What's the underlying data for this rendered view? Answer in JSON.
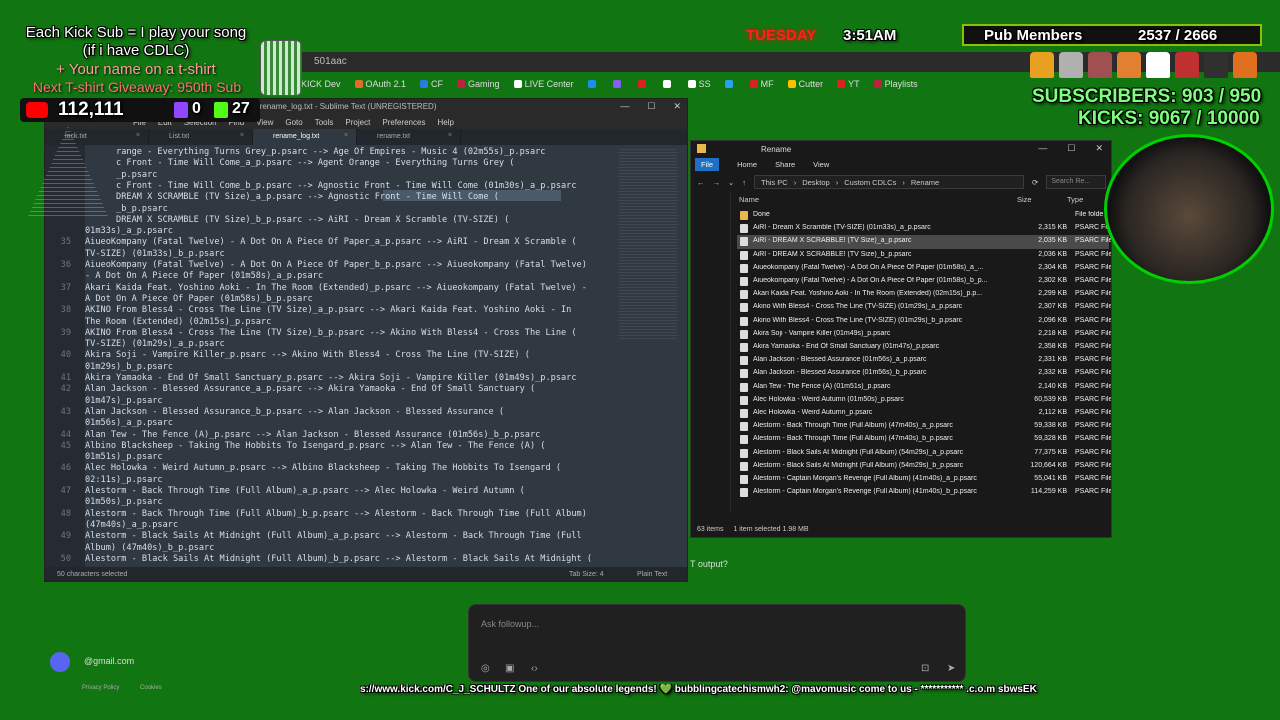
{
  "stream": {
    "kick_sub_line1": "Each Kick Sub = I play your song",
    "kick_sub_line2": "(if i have CDLC)",
    "tshirt_line": "+ Your name on a t-shirt",
    "giveaway_line": "Next T-shirt Giveaway: 950th Sub",
    "youtube_count": "112,111",
    "twitch_count": "0",
    "kick_count": "27",
    "day": "TUESDAY",
    "time": "3:51AM",
    "pub_members_label": "Pub Members",
    "pub_members_value": "2537 / 2666",
    "subscribers": "SUBSCRIBERS: 903 / 950",
    "kicks": "KICKS: 9067 / 10000",
    "ticker": "s://www.kick.com/C_J_SCHULTZ One of our absolute legends! 💚 bubblingcatechismwh2: @mavomusic come to us - *********** .c.o.m sbwsEK",
    "email_fragment": "@gmail.com",
    "privacy": "Privacy Policy",
    "cookies": "Cookies",
    "output_prompt": "T output?",
    "followup_placeholder": "Ask followup..."
  },
  "browser": {
    "url_fragment": "501aac",
    "bookmarks": [
      {
        "label": "KICK Dev",
        "color": "#53fc18"
      },
      {
        "label": "OAuth 2.1",
        "color": "#e06c2a"
      },
      {
        "label": "CF",
        "color": "#2a7be0"
      },
      {
        "label": "Gaming",
        "color": "#c02040"
      },
      {
        "label": "LIVE Center",
        "color": "#ffffff"
      },
      {
        "label": "",
        "color": "#1a8ff0"
      },
      {
        "label": "",
        "color": "#8a5cf0"
      },
      {
        "label": "",
        "color": "#e02020"
      },
      {
        "label": "",
        "color": "#ffffff"
      },
      {
        "label": "SS",
        "color": "#ffffff"
      },
      {
        "label": "",
        "color": "#2aa0f0"
      },
      {
        "label": "MF",
        "color": "#e02020"
      },
      {
        "label": "Cutter",
        "color": "#ffbf00"
      },
      {
        "label": "YT",
        "color": "#e02020"
      },
      {
        "label": "Playlists",
        "color": "#c02040"
      }
    ]
  },
  "sublime": {
    "title": "~\\Custom CDLCs\\rename_log.txt - Sublime Text (UNREGISTERED)",
    "menu": [
      "File",
      "Edit",
      "Selection",
      "Find",
      "View",
      "Goto",
      "Tools",
      "Project",
      "Preferences",
      "Help"
    ],
    "tabs": [
      {
        "label": "lock.txt",
        "active": false
      },
      {
        "label": "List.txt",
        "active": false
      },
      {
        "label": "rename_log.txt",
        "active": true
      },
      {
        "label": "rename.txt",
        "active": false
      }
    ],
    "lines": [
      {
        "n": "",
        "t": "      range - Everything Turns Grey_p.psarc --> Age Of Empires - Music 4 (02m55s)_p.psarc"
      },
      {
        "n": "",
        "t": "      c Front - Time Will Come_a_p.psarc --> Agent Orange - Everything Turns Grey ("
      },
      {
        "n": "",
        "t": "      _p.psarc"
      },
      {
        "n": "",
        "t": "      c Front - Time Will Come_b_p.psarc --> Agnostic Front - Time Will Come (01m30s)_a_p.psarc"
      },
      {
        "n": "",
        "t": "      DREAM X SCRAMBLE (TV Size)_a_p.psarc --> Agnostic Front - Time Will Come ("
      },
      {
        "n": "",
        "t": "      _b_p.psarc"
      },
      {
        "n": "",
        "t": "      DREAM X SCRAMBLE (TV Size)_b_p.psarc --> AiRI - Dream X Scramble (TV-SIZE) ("
      },
      {
        "n": "",
        "t": "01m33s)_a_p.psarc"
      },
      {
        "n": "35",
        "t": "AiueoKompany (Fatal Twelve) - A Dot On A Piece Of Paper_a_p.psarc --> AiRI - Dream X Scramble ("
      },
      {
        "n": "",
        "t": "TV-SIZE) (01m33s)_b_p.psarc"
      },
      {
        "n": "36",
        "t": "AiueoKompany (Fatal Twelve) - A Dot On A Piece Of Paper_b_p.psarc --> Aiueokompany (Fatal Twelve)"
      },
      {
        "n": "",
        "t": "- A Dot On A Piece Of Paper (01m58s)_a_p.psarc"
      },
      {
        "n": "37",
        "t": "Akari Kaida Feat. Yoshino Aoki - In The Room (Extended)_p.psarc --> Aiueokompany (Fatal Twelve) -"
      },
      {
        "n": "",
        "t": "A Dot On A Piece Of Paper (01m58s)_b_p.psarc"
      },
      {
        "n": "38",
        "t": "AKINO From Bless4 - Cross The Line (TV Size)_a_p.psarc --> Akari Kaida Feat. Yoshino Aoki - In"
      },
      {
        "n": "",
        "t": "The Room (Extended) (02m15s)_p.psarc"
      },
      {
        "n": "39",
        "t": "AKINO From Bless4 - Cross The Line (TV Size)_b_p.psarc --> Akino With Bless4 - Cross The Line ("
      },
      {
        "n": "",
        "t": "TV-SIZE) (01m29s)_a_p.psarc"
      },
      {
        "n": "40",
        "t": "Akira Soji - Vampire Killer_p.psarc --> Akino With Bless4 - Cross The Line (TV-SIZE) ("
      },
      {
        "n": "",
        "t": "01m29s)_b_p.psarc"
      },
      {
        "n": "41",
        "t": "Akira Yamaoka - End Of Small Sanctuary_p.psarc --> Akira Soji - Vampire Killer (01m49s)_p.psarc"
      },
      {
        "n": "42",
        "t": "Alan Jackson - Blessed Assurance_a_p.psarc --> Akira Yamaoka - End Of Small Sanctuary ("
      },
      {
        "n": "",
        "t": "01m47s)_p.psarc"
      },
      {
        "n": "43",
        "t": "Alan Jackson - Blessed Assurance_b_p.psarc --> Alan Jackson - Blessed Assurance ("
      },
      {
        "n": "",
        "t": "01m56s)_a_p.psarc"
      },
      {
        "n": "44",
        "t": "Alan Tew - The Fence (A)_p.psarc --> Alan Jackson - Blessed Assurance (01m56s)_b_p.psarc"
      },
      {
        "n": "45",
        "t": "Albino Blacksheep - Taking The Hobbits To Isengard_p.psarc --> Alan Tew - The Fence (A) ("
      },
      {
        "n": "",
        "t": "01m51s)_p.psarc"
      },
      {
        "n": "46",
        "t": "Alec Holowka - Weird Autumn_p.psarc --> Albino Blacksheep - Taking The Hobbits To Isengard ("
      },
      {
        "n": "",
        "t": "02:11s)_p.psarc"
      },
      {
        "n": "47",
        "t": "Alestorm - Back Through Time (Full Album)_a_p.psarc --> Alec Holowka - Weird Autumn ("
      },
      {
        "n": "",
        "t": "01m50s)_p.psarc"
      },
      {
        "n": "48",
        "t": "Alestorm - Back Through Time (Full Album)_b_p.psarc --> Alestorm - Back Through Time (Full Album)"
      },
      {
        "n": "",
        "t": "(47m40s)_a_p.psarc"
      },
      {
        "n": "49",
        "t": "Alestorm - Black Sails At Midnight (Full Album)_a_p.psarc --> Alestorm - Back Through Time (Full"
      },
      {
        "n": "",
        "t": "Album) (47m40s)_b_p.psarc"
      },
      {
        "n": "50",
        "t": "Alestorm - Black Sails At Midnight (Full Album)_b_p.psarc --> Alestorm - Black Sails At Midnight ("
      }
    ],
    "status_left": "50 characters selected",
    "status_tab": "Tab Size: 4",
    "status_syntax": "Plain Text"
  },
  "explorer": {
    "title": "Rename",
    "ribbon": [
      "File",
      "Home",
      "Share",
      "View"
    ],
    "breadcrumb": [
      "This PC",
      "Desktop",
      "Custom CDLCs",
      "Rename"
    ],
    "search_placeholder": "Search Re...",
    "col_name": "Name",
    "col_size": "Size",
    "col_type": "Type",
    "rows": [
      {
        "name": "Done",
        "size": "",
        "type": "File folde",
        "folder": true,
        "sel": false
      },
      {
        "name": "AiRI - Dream X Scramble (TV-SIZE) (01m33s)_a_p.psarc",
        "size": "2,315 KB",
        "type": "PSARC Fi",
        "folder": false,
        "sel": false
      },
      {
        "name": "AiRI - DREAM X SCRABBLE! (TV Size)_a_p.psarc",
        "size": "2,035 KB",
        "type": "PSARC File",
        "folder": false,
        "sel": true
      },
      {
        "name": "AiRI - DREAM X SCRABBLE! (TV Size)_b_p.psarc",
        "size": "2,036 KB",
        "type": "PSARC File",
        "folder": false,
        "sel": false
      },
      {
        "name": "Aiueokompany (Fatal Twelve) - A Dot On A Piece Of Paper (01m58s)_a_...",
        "size": "2,304 KB",
        "type": "PSARC File",
        "folder": false,
        "sel": false
      },
      {
        "name": "Aiueokompany (Fatal Twelve) - A Dot On A Piece Of Paper (01m58s)_b_p...",
        "size": "2,302 KB",
        "type": "PSARC File",
        "folder": false,
        "sel": false
      },
      {
        "name": "Akari Kaida Feat. Yoshino Aoki - In The Room (Extended) (02m15s)_p.p...",
        "size": "2,299 KB",
        "type": "PSARC File",
        "folder": false,
        "sel": false
      },
      {
        "name": "Akino With Bless4 - Cross The Line (TV-SIZE) (01m29s)_a_p.psarc",
        "size": "2,307 KB",
        "type": "PSARC File",
        "folder": false,
        "sel": false
      },
      {
        "name": "Akino With Bless4 - Cross The Line (TV-SIZE) (01m29s)_b_p.psarc",
        "size": "2,096 KB",
        "type": "PSARC File",
        "folder": false,
        "sel": false
      },
      {
        "name": "Akira Soji - Vampire Killer (01m49s)_p.psarc",
        "size": "2,218 KB",
        "type": "PSARC File",
        "folder": false,
        "sel": false
      },
      {
        "name": "Akira Yamaoka - End Of Small Sanctuary (01m47s)_p.psarc",
        "size": "2,358 KB",
        "type": "PSARC File",
        "folder": false,
        "sel": false
      },
      {
        "name": "Alan Jackson - Blessed Assurance (01m56s)_a_p.psarc",
        "size": "2,331 KB",
        "type": "PSARC File",
        "folder": false,
        "sel": false
      },
      {
        "name": "Alan Jackson - Blessed Assurance (01m56s)_b_p.psarc",
        "size": "2,332 KB",
        "type": "PSARC File",
        "folder": false,
        "sel": false
      },
      {
        "name": "Alan Tew - The Fence (A) (01m51s)_p.psarc",
        "size": "2,140 KB",
        "type": "PSARC File",
        "folder": false,
        "sel": false
      },
      {
        "name": "Alec Holowka - Weird Autumn (01m50s)_p.psarc",
        "size": "60,539 KB",
        "type": "PSARC File",
        "folder": false,
        "sel": false
      },
      {
        "name": "Alec Holowka - Weird Autumn_p.psarc",
        "size": "2,112 KB",
        "type": "PSARC File",
        "folder": false,
        "sel": false
      },
      {
        "name": "Alestorm - Back Through Time (Full Album) (47m40s)_a_p.psarc",
        "size": "59,338 KB",
        "type": "PSARC File",
        "folder": false,
        "sel": false
      },
      {
        "name": "Alestorm - Back Through Time (Full Album) (47m40s)_b_p.psarc",
        "size": "59,328 KB",
        "type": "PSARC File",
        "folder": false,
        "sel": false
      },
      {
        "name": "Alestorm - Black Sails At Midnight (Full Album) (54m29s)_a_p.psarc",
        "size": "77,375 KB",
        "type": "PSARC File",
        "folder": false,
        "sel": false
      },
      {
        "name": "Alestorm - Black Sails At Midnight (Full Album) (54m29s)_b_p.psarc",
        "size": "120,664 KB",
        "type": "PSARC File",
        "folder": false,
        "sel": false
      },
      {
        "name": "Alestorm - Captain Morgan's Revenge (Full Album) (41m40s)_a_p.psarc",
        "size": "55,041 KB",
        "type": "PSARC File",
        "folder": false,
        "sel": false
      },
      {
        "name": "Alestorm - Captain Morgan's Revenge (Full Album) (41m40s)_b_p.psarc",
        "size": "114,259 KB",
        "type": "PSARC File",
        "folder": false,
        "sel": false
      }
    ],
    "status_items": "63 items",
    "status_selected": "1 item selected  1.98 MB"
  }
}
